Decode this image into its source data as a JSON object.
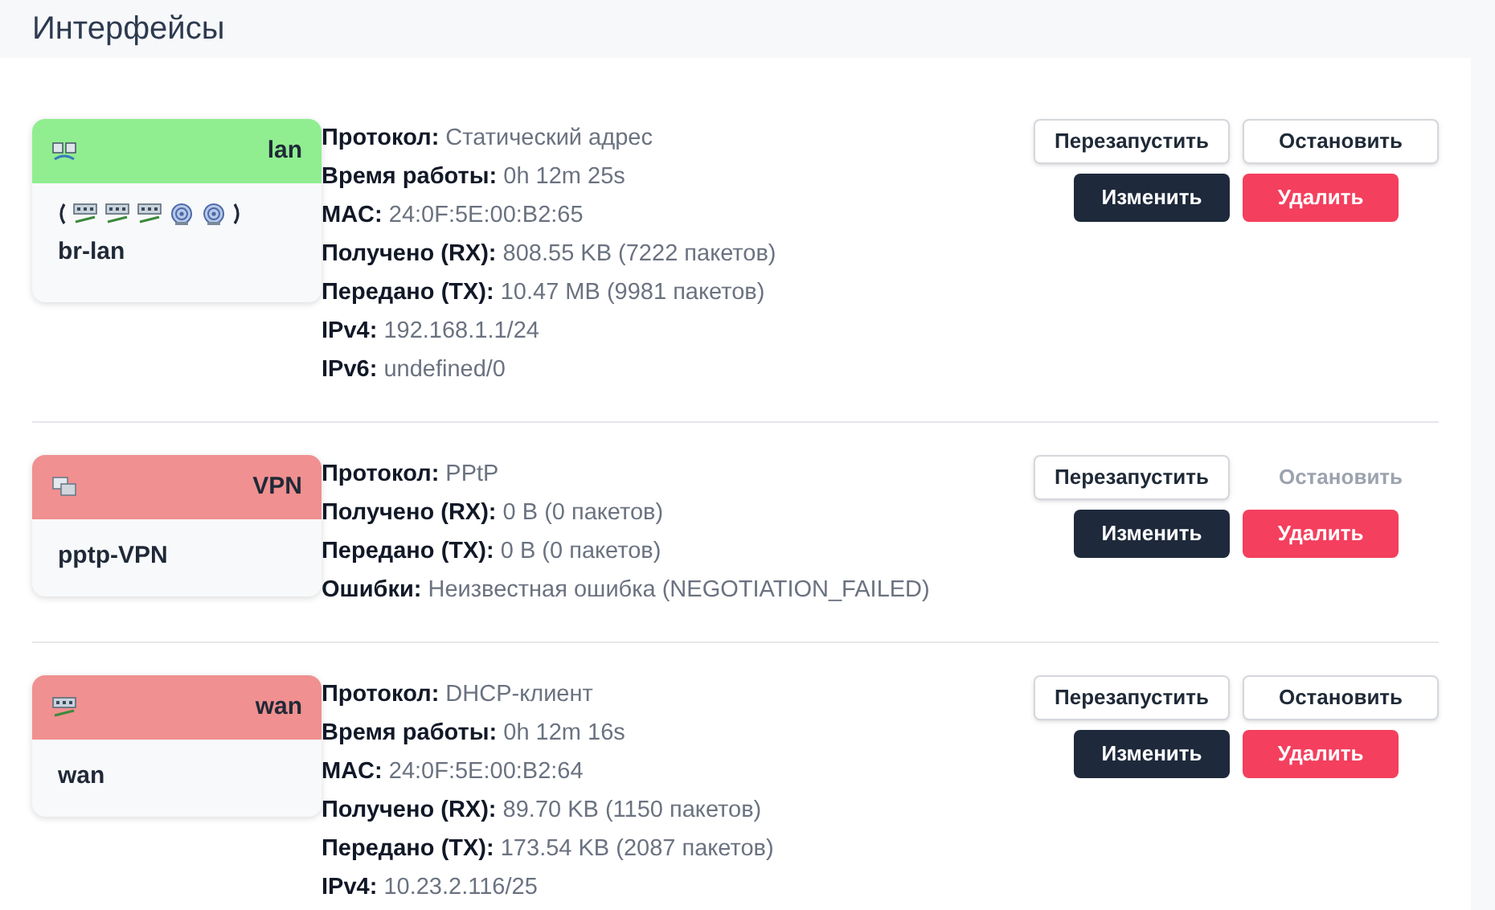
{
  "page_title": "Интерфейсы",
  "interfaces": [
    {
      "name": "lan",
      "color": "#90ee90",
      "kind": "bridge",
      "ports": [
        {
          "kind": "ethernet"
        },
        {
          "kind": "ethernet"
        },
        {
          "kind": "ethernet"
        },
        {
          "kind": "wireless"
        },
        {
          "kind": "wireless"
        }
      ],
      "device": "br-lan",
      "details": [
        "**Протокол:** Статический адрес",
        "**Время работы:** 0h 12m 25s",
        "**MAC:** 24:0F:5E:00:B2:65",
        "**Получено (RX):** 808.55 KB (7222 пакетов)",
        "**Передано (TX):** 10.47 MB (9981 пакетов)",
        "**IPv4:** 192.168.1.1/24",
        "**IPv6:** undefined/0"
      ],
      "buttons": [
        {
          "label": "Перезапустить",
          "kind": "outline",
          "disabled": false
        },
        {
          "label": "Остановить",
          "kind": "outline",
          "disabled": false
        },
        {
          "label": "Изменить",
          "kind": "dark",
          "disabled": false
        },
        {
          "label": "Удалить",
          "kind": "danger",
          "disabled": false
        }
      ]
    },
    {
      "name": "VPN",
      "color": "#f09090",
      "kind": "tunnel",
      "device": "pptp-VPN",
      "details": [
        "**Протокол:** PPtP",
        "**Получено (RX):** 0 B (0 пакетов)",
        "**Передано (TX):** 0 B (0 пакетов)",
        "**Ошибки:** Неизвестная ошибка (NEGOTIATION_FAILED)"
      ],
      "buttons": [
        {
          "label": "Перезапустить",
          "kind": "outline",
          "disabled": false
        },
        {
          "label": "Остановить",
          "kind": "outline",
          "disabled": true
        },
        {
          "label": "Изменить",
          "kind": "dark",
          "disabled": false
        },
        {
          "label": "Удалить",
          "kind": "danger",
          "disabled": false
        }
      ]
    },
    {
      "name": "wan",
      "color": "#f09090",
      "kind": "ethernet",
      "device": "wan",
      "details": [
        "**Протокол:** DHCP-клиент",
        "**Время работы:** 0h 12m 16s",
        "**MAC:** 24:0F:5E:00:B2:64",
        "**Получено (RX):** 89.70 KB (1150 пакетов)",
        "**Передано (TX):** 173.54 KB (2087 пакетов)",
        "**IPv4:** 10.23.2.116/25"
      ],
      "buttons": [
        {
          "label": "Перезапустить",
          "kind": "outline",
          "disabled": false
        },
        {
          "label": "Остановить",
          "kind": "outline",
          "disabled": false
        },
        {
          "label": "Изменить",
          "kind": "dark",
          "disabled": false
        },
        {
          "label": "Удалить",
          "kind": "danger",
          "disabled": false
        }
      ]
    }
  ]
}
